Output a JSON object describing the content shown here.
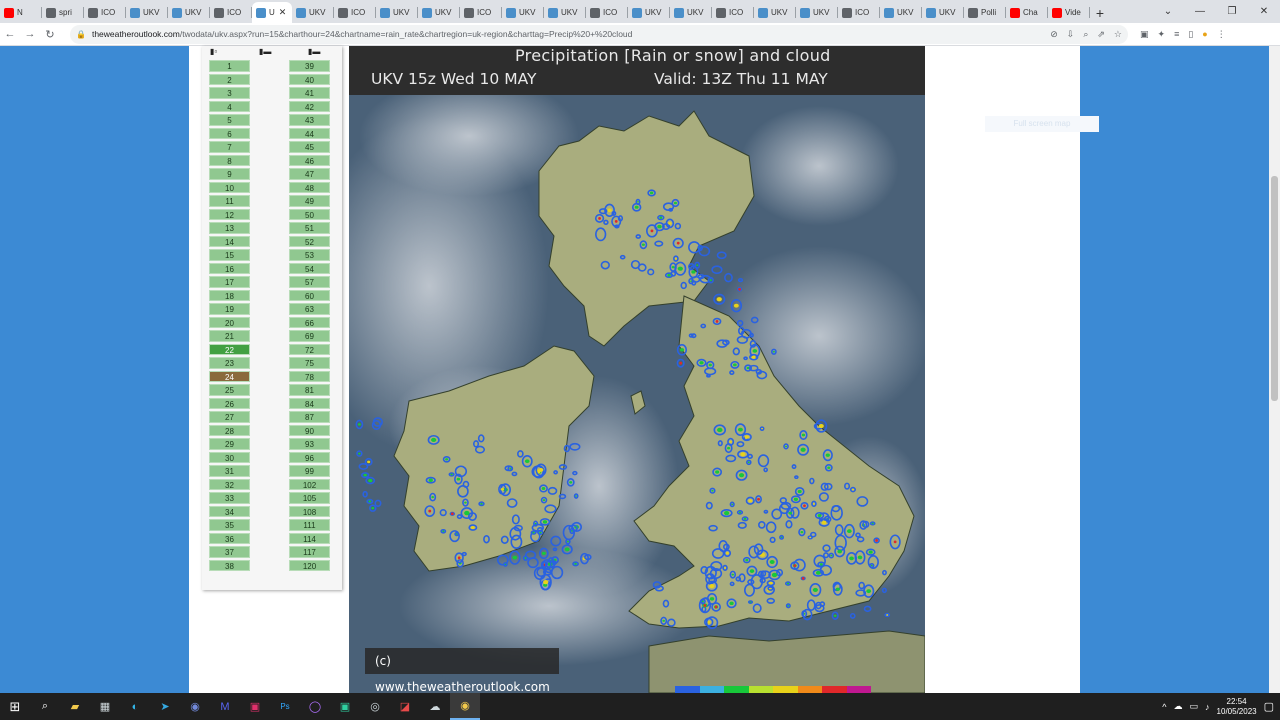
{
  "browser": {
    "tabs": [
      {
        "label": "N",
        "color": "#ff0000"
      },
      {
        "label": "spri",
        "color": "#5f6368"
      },
      {
        "label": "ICO",
        "color": "#5f6368"
      },
      {
        "label": "UKV",
        "color": "#4a8fc9"
      },
      {
        "label": "UKV",
        "color": "#4a8fc9"
      },
      {
        "label": "ICO",
        "color": "#5f6368"
      },
      {
        "label": "U",
        "color": "#4a8fc9",
        "active": true
      },
      {
        "label": "UKV",
        "color": "#4a8fc9"
      },
      {
        "label": "ICO",
        "color": "#5f6368"
      },
      {
        "label": "UKV",
        "color": "#4a8fc9"
      },
      {
        "label": "UKV",
        "color": "#4a8fc9"
      },
      {
        "label": "ICO",
        "color": "#5f6368"
      },
      {
        "label": "UKV",
        "color": "#4a8fc9"
      },
      {
        "label": "UKV",
        "color": "#4a8fc9"
      },
      {
        "label": "ICO",
        "color": "#5f6368"
      },
      {
        "label": "UKV",
        "color": "#4a8fc9"
      },
      {
        "label": "UKV",
        "color": "#4a8fc9"
      },
      {
        "label": "ICO",
        "color": "#5f6368"
      },
      {
        "label": "UKV",
        "color": "#4a8fc9"
      },
      {
        "label": "UKV",
        "color": "#4a8fc9"
      },
      {
        "label": "ICO",
        "color": "#5f6368"
      },
      {
        "label": "UKV",
        "color": "#4a8fc9"
      },
      {
        "label": "UKV",
        "color": "#4a8fc9"
      },
      {
        "label": "Polli",
        "color": "#5f6368"
      },
      {
        "label": "Cha",
        "color": "#ff0000"
      },
      {
        "label": "Vide",
        "color": "#ff0000"
      }
    ],
    "url_host": "theweatheroutlook.com",
    "url_path": "/twodata/ukv.aspx?run=15&charthour=24&chartname=rain_rate&chartregion=uk-region&charttag=Precip%20+%20cloud"
  },
  "page": {
    "hours_left": [
      "1",
      "2",
      "3",
      "4",
      "5",
      "6",
      "7",
      "8",
      "9",
      "10",
      "11",
      "12",
      "13",
      "14",
      "15",
      "16",
      "17",
      "18",
      "19",
      "20",
      "21",
      "22",
      "23",
      "24",
      "25",
      "26",
      "27",
      "28",
      "29",
      "30",
      "31",
      "32",
      "33",
      "34",
      "35",
      "36",
      "37",
      "38"
    ],
    "hours_right": [
      "39",
      "40",
      "41",
      "42",
      "43",
      "44",
      "45",
      "46",
      "47",
      "48",
      "49",
      "50",
      "51",
      "52",
      "53",
      "54",
      "57",
      "60",
      "63",
      "66",
      "69",
      "72",
      "75",
      "78",
      "81",
      "84",
      "87",
      "90",
      "93",
      "96",
      "99",
      "102",
      "105",
      "108",
      "111",
      "114",
      "117",
      "120"
    ],
    "current_hour": "22",
    "selected_hour": "24",
    "ghost_button": "Full screen map",
    "chart": {
      "title": "Precipitation [Rain or snow] and cloud",
      "run": "UKV 15z Wed 10 MAY",
      "valid": "Valid: 13Z Thu 11 MAY",
      "copyright": "(c) www.theweatheroutlook.com",
      "colors": {
        "sea": "#4a6178",
        "land": "#a9ad7e",
        "cloud": "#c8ccd2",
        "rain_light": "#2a62e0",
        "rain_mid": "#18c83a",
        "rain_heavy": "#e8d21a",
        "rain_extreme": "#e0282a"
      }
    }
  },
  "taskbar": {
    "time": "22:54",
    "date": "10/05/2023"
  }
}
